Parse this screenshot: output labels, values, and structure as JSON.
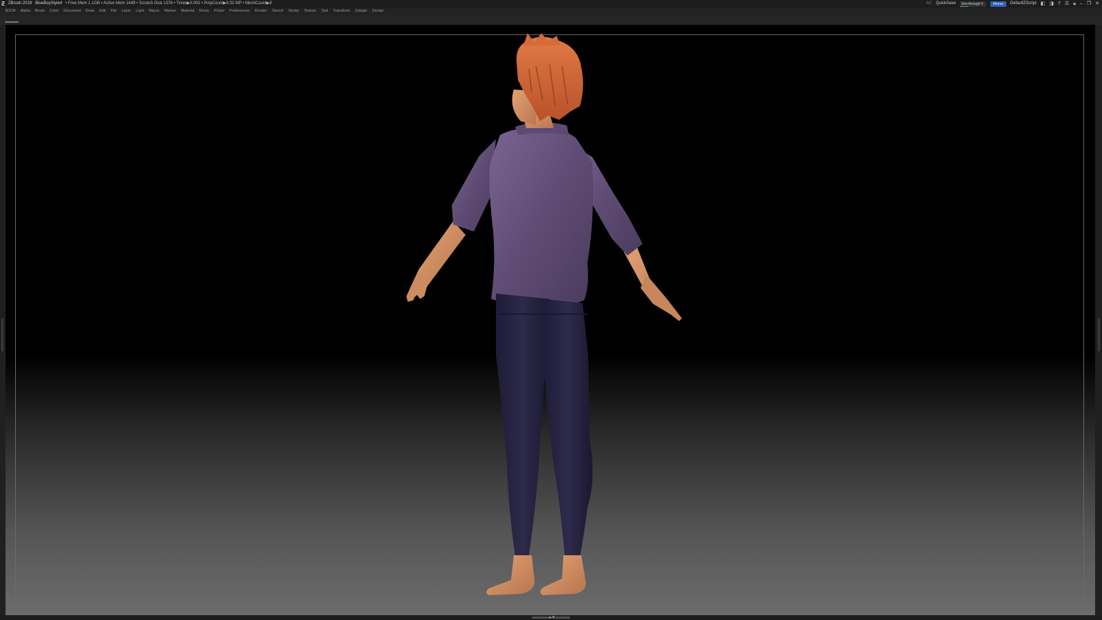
{
  "titlebar": {
    "app_name": "ZBrush 2019",
    "project": "BlueBoyStyle4",
    "stats": "• Free Mem 1.1GB • Active Mem 1449 • Scratch Disk 1376 • Timer▶0.002 • PolyCount▶8.32 MP • MeshCount▶8",
    "ac_label": "AC",
    "quicksave_label": "QuickSave",
    "seethrough_label": "See-through",
    "seethrough_value": "0",
    "menus_label": "Menus",
    "script_label": "DefaultZScript"
  },
  "menubar": {
    "items": [
      "3DCM",
      "Alpha",
      "Brush",
      "Color",
      "Document",
      "Draw",
      "Edit",
      "File",
      "Layer",
      "Light",
      "Macro",
      "Marker",
      "Material",
      "Movie",
      "Picker",
      "Preferences",
      "Render",
      "Stencil",
      "Stroke",
      "Texture",
      "Tool",
      "Transform",
      "Zplugin",
      "Zscript"
    ]
  },
  "colors": {
    "accent_menus": "#2f62b4",
    "seethrough_fill": "#4da64d",
    "shirt": "#6a5580",
    "pants": "#262342",
    "skin": "#d39066",
    "hair": "#d0673a"
  },
  "icons": {
    "logo": "zbrush-logo-icon",
    "window_controls": [
      "layout-icon",
      "layout-alt-icon",
      "help-icon",
      "preset-icon",
      "lock-icon",
      "minimize-icon",
      "restore-icon",
      "close-icon"
    ]
  }
}
